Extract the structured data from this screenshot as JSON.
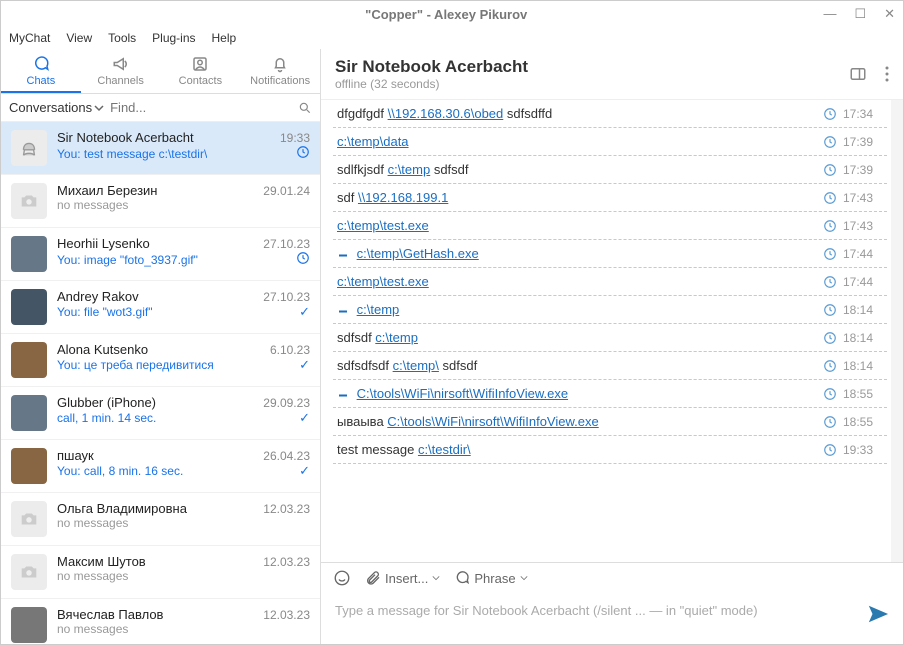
{
  "title": "\"Copper\" - Alexey Pikurov",
  "menu": {
    "items": [
      "MyChat",
      "View",
      "Tools",
      "Plug-ins",
      "Help"
    ]
  },
  "tabs": [
    {
      "id": "chats",
      "label": "Chats",
      "active": true
    },
    {
      "id": "channels",
      "label": "Channels",
      "active": false
    },
    {
      "id": "contacts",
      "label": "Contacts",
      "active": false
    },
    {
      "id": "notifications",
      "label": "Notifications",
      "active": false
    }
  ],
  "search": {
    "toggle": "Conversations",
    "placeholder": "Find..."
  },
  "chats": [
    {
      "name": "Sir Notebook Acerbacht",
      "date": "19:33",
      "preview": "You: test message c:\\testdir\\",
      "previewType": "blue",
      "status": "clock",
      "active": true,
      "avatar": "chair"
    },
    {
      "name": "Михаил Березин",
      "date": "29.01.24",
      "preview": "no messages",
      "previewType": "gray",
      "status": "",
      "avatar": "none"
    },
    {
      "name": "Heorhii Lysenko",
      "date": "27.10.23",
      "preview": "You: image \"foto_3937.gif\"",
      "previewType": "blue",
      "status": "clock",
      "avatar": "photo"
    },
    {
      "name": "Andrey Rakov",
      "date": "27.10.23",
      "preview": "You: file \"wot3.gif\"",
      "previewType": "blue",
      "status": "check",
      "avatar": "photo3"
    },
    {
      "name": "Alona Kutsenko",
      "date": "6.10.23",
      "preview": "You: це треба передивитися",
      "previewType": "blue",
      "status": "check",
      "avatar": "photo2"
    },
    {
      "name": "Glubber (iPhone)",
      "date": "29.09.23",
      "preview": "call, 1 min. 14 sec.",
      "previewType": "blue",
      "status": "check",
      "avatar": "photo"
    },
    {
      "name": "пшаук",
      "date": "26.04.23",
      "preview": "You: call, 8 min. 16 sec.",
      "previewType": "blue",
      "status": "check",
      "avatar": "photo2"
    },
    {
      "name": "Ольга Владимировна",
      "date": "12.03.23",
      "preview": "no messages",
      "previewType": "gray",
      "status": "",
      "avatar": "none"
    },
    {
      "name": "Максим Шутов",
      "date": "12.03.23",
      "preview": "no messages",
      "previewType": "gray",
      "status": "",
      "avatar": "none"
    },
    {
      "name": "Вячеслав Павлов",
      "date": "12.03.23",
      "preview": "no messages",
      "previewType": "gray",
      "status": "",
      "avatar": "photo4"
    }
  ],
  "header": {
    "name": "Sir Notebook Acerbacht",
    "status_label": "offline",
    "status_detail": "(32 seconds)"
  },
  "messages": [
    {
      "parts": [
        {
          "t": "text",
          "v": "dfgdfgdf "
        },
        {
          "t": "link",
          "v": "\\\\192.168.30.6\\obed"
        },
        {
          "t": "text",
          "v": " sdfsdffd"
        }
      ],
      "time": "17:34"
    },
    {
      "parts": [
        {
          "t": "link",
          "v": "c:\\temp\\data"
        }
      ],
      "time": "17:39"
    },
    {
      "parts": [
        {
          "t": "text",
          "v": "sdlfkjsdf "
        },
        {
          "t": "link",
          "v": "c:\\temp"
        },
        {
          "t": "text",
          "v": " sdfsdf"
        }
      ],
      "time": "17:39"
    },
    {
      "parts": [
        {
          "t": "text",
          "v": "sdf "
        },
        {
          "t": "link",
          "v": "\\\\192.168.199.1"
        }
      ],
      "time": "17:43"
    },
    {
      "parts": [
        {
          "t": "link",
          "v": "c:\\temp\\test.exe"
        }
      ],
      "time": "17:43"
    },
    {
      "parts": [
        {
          "t": "dl"
        },
        {
          "t": "link",
          "v": "c:\\temp\\GetHash.exe"
        }
      ],
      "time": "17:44"
    },
    {
      "parts": [
        {
          "t": "link",
          "v": "c:\\temp\\test.exe"
        }
      ],
      "time": "17:44"
    },
    {
      "parts": [
        {
          "t": "dl"
        },
        {
          "t": "link",
          "v": "c:\\temp"
        }
      ],
      "time": "18:14"
    },
    {
      "parts": [
        {
          "t": "text",
          "v": "sdfsdf "
        },
        {
          "t": "link",
          "v": "c:\\temp"
        }
      ],
      "time": "18:14"
    },
    {
      "parts": [
        {
          "t": "text",
          "v": "sdfsdfsdf "
        },
        {
          "t": "link",
          "v": "c:\\temp\\"
        },
        {
          "t": "text",
          "v": " sdfsdf"
        }
      ],
      "time": "18:14"
    },
    {
      "parts": [
        {
          "t": "dl"
        },
        {
          "t": "link",
          "v": "C:\\tools\\WiFi\\nirsoft\\WifiInfoView.exe"
        }
      ],
      "time": "18:55"
    },
    {
      "parts": [
        {
          "t": "text",
          "v": "ываыва "
        },
        {
          "t": "link",
          "v": "C:\\tools\\WiFi\\nirsoft\\WifiInfoView.exe"
        }
      ],
      "time": "18:55"
    },
    {
      "parts": [
        {
          "t": "text",
          "v": "test message "
        },
        {
          "t": "link",
          "v": "c:\\testdir\\"
        }
      ],
      "time": "19:33"
    }
  ],
  "composer": {
    "insert": "Insert...",
    "phrase": "Phrase",
    "placeholder": "Type a message for Sir Notebook Acerbacht (/silent ... — in \"quiet\" mode)"
  }
}
